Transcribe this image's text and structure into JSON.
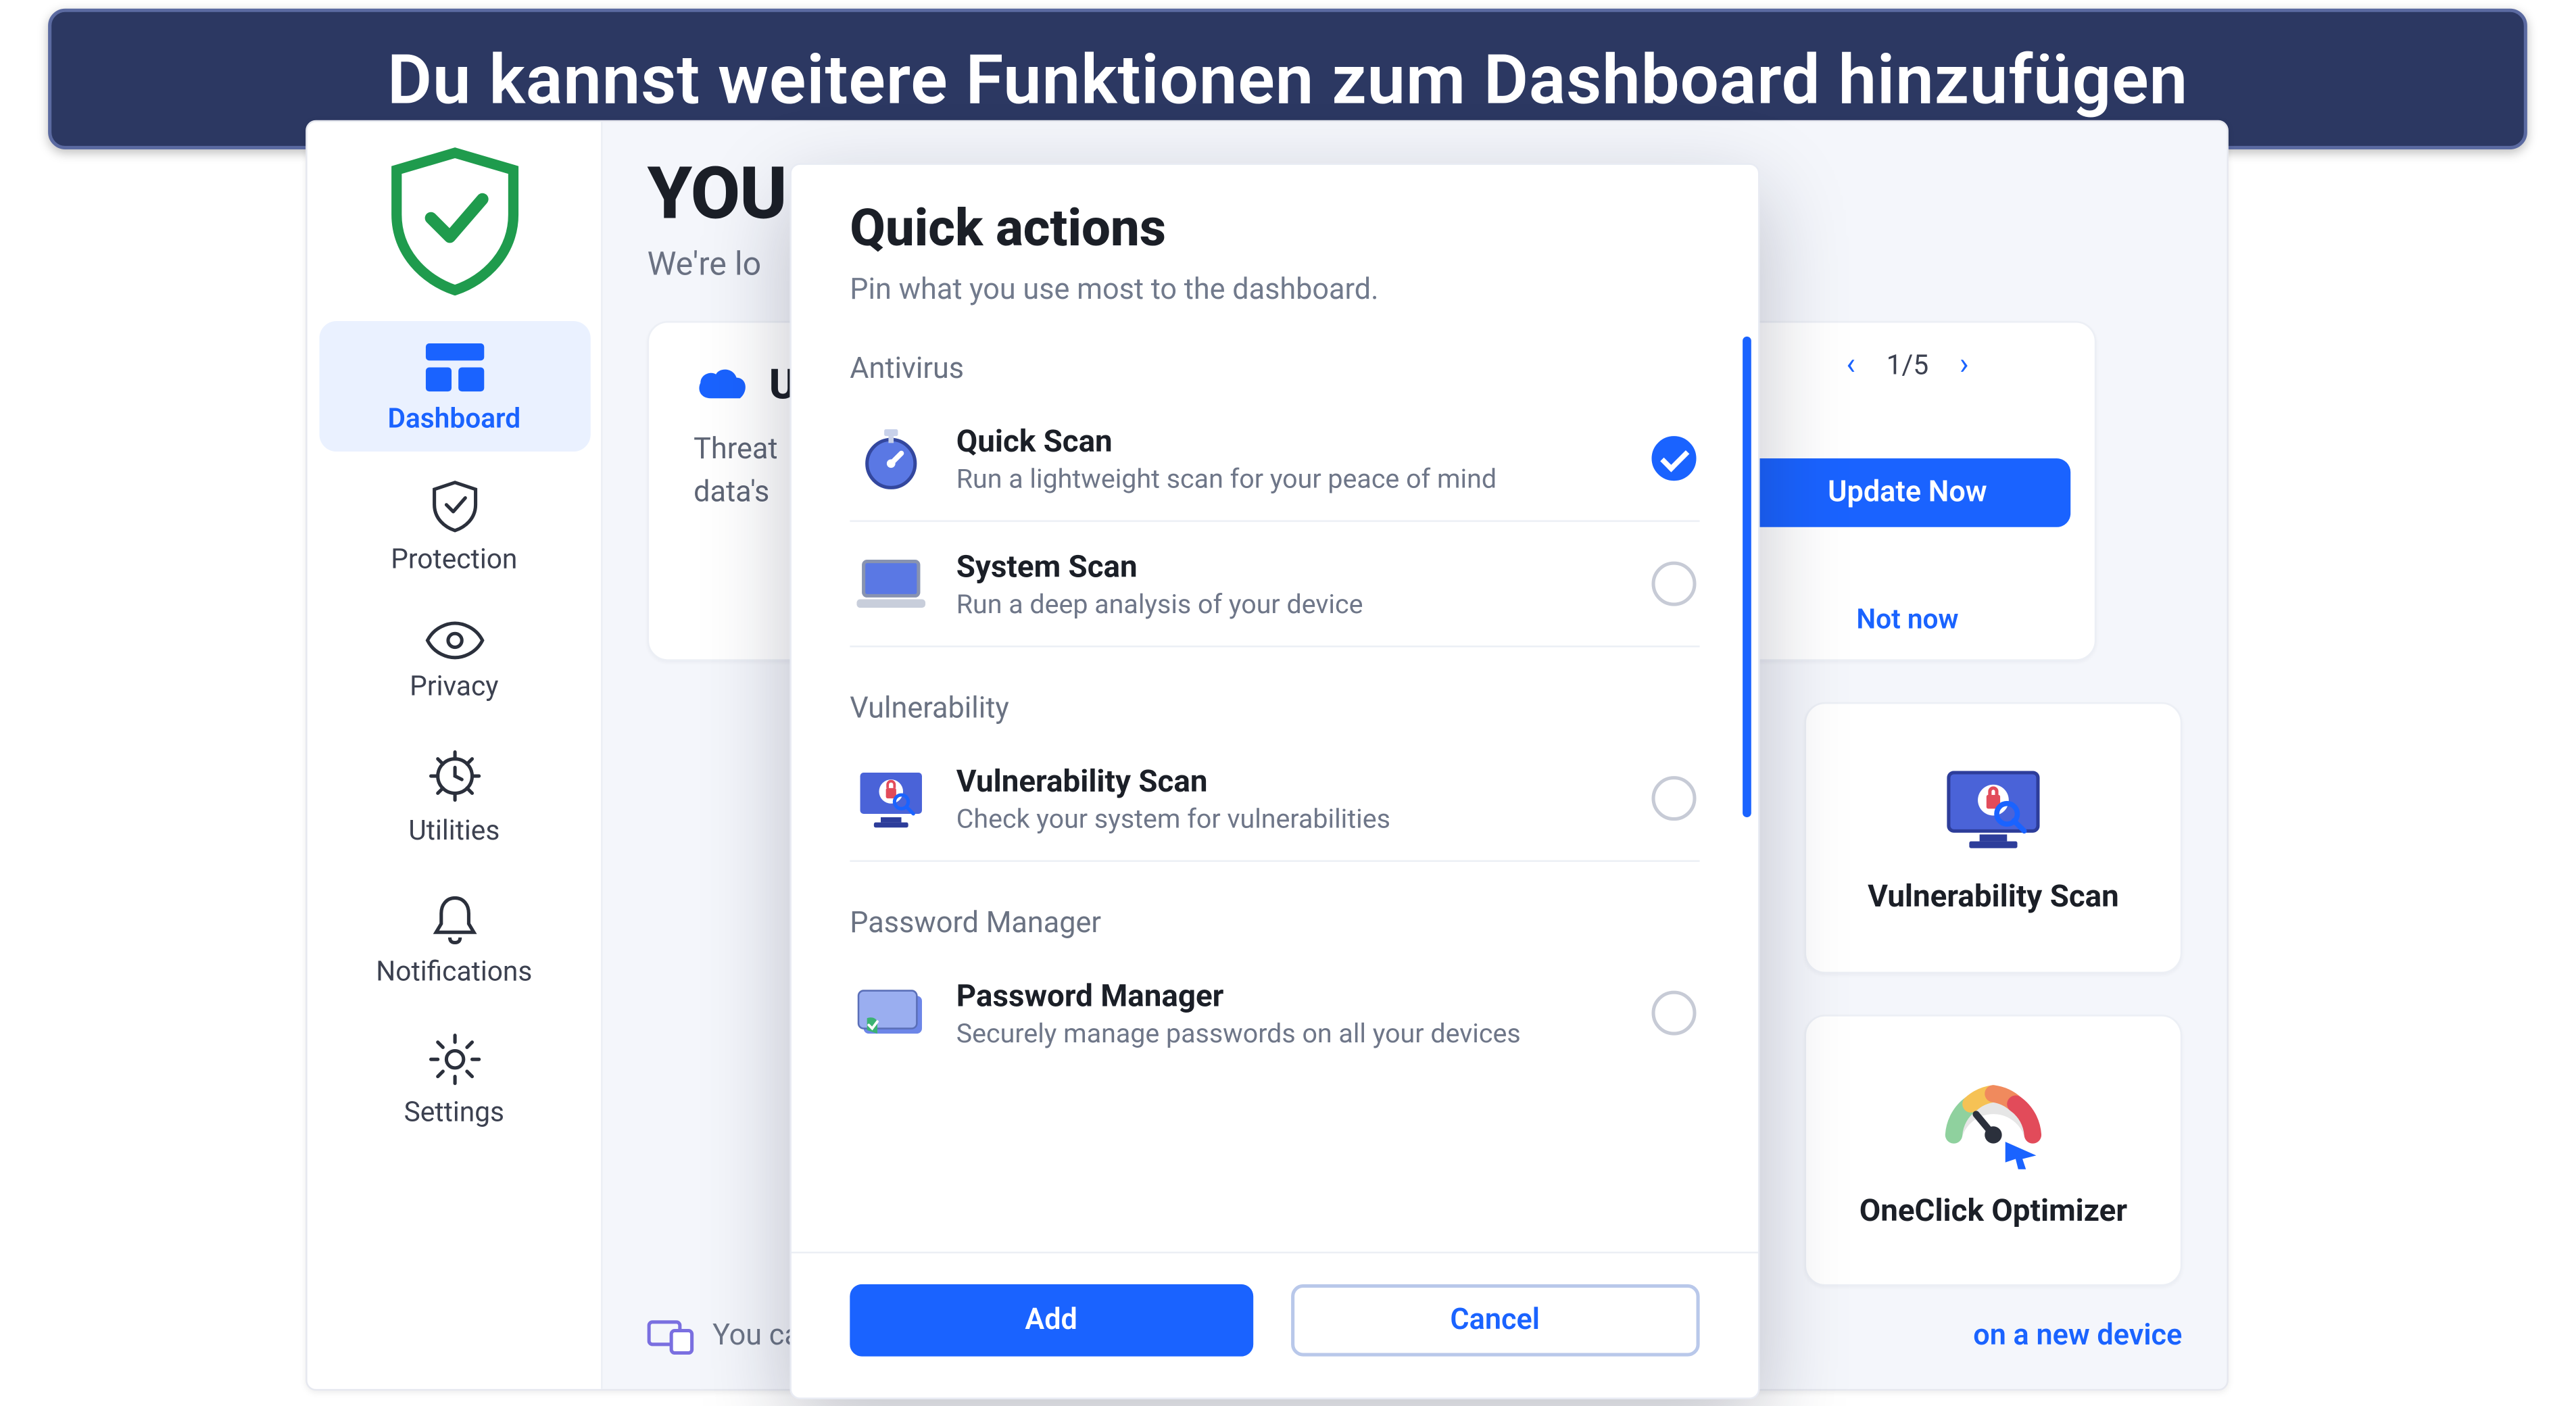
{
  "banner": {
    "text": "Du kannst weitere Funktionen zum Dashboard hinzufügen"
  },
  "sidebar": {
    "items": [
      {
        "label": "Dashboard"
      },
      {
        "label": "Protection"
      },
      {
        "label": "Privacy"
      },
      {
        "label": "Utilities"
      },
      {
        "label": "Notifications"
      },
      {
        "label": "Settings"
      }
    ]
  },
  "header": {
    "title_fragment": "YOU",
    "subtitle_fragment": "We're lo"
  },
  "threat_card": {
    "icon": "cloud-icon",
    "title_fragment": "U",
    "line1_fragment": "Threat",
    "line2_fragment": "data's"
  },
  "update_card": {
    "pager": {
      "current": "1",
      "total": "5",
      "display": "1/5"
    },
    "primary": "Update Now",
    "dismiss": "Not now"
  },
  "tiles": [
    {
      "label": "Vulnerability Scan"
    },
    {
      "label": "OneClick Optimizer"
    }
  ],
  "bottom": {
    "prefix": "You ca",
    "link_fragment": "on a new device"
  },
  "modal": {
    "title": "Quick actions",
    "subtitle": "Pin what you use most to the dashboard.",
    "sections": [
      {
        "heading": "Antivirus",
        "items": [
          {
            "name": "Quick Scan",
            "desc": "Run a lightweight scan for your peace of mind",
            "checked": true
          },
          {
            "name": "System Scan",
            "desc": "Run a deep analysis of your device",
            "checked": false
          }
        ]
      },
      {
        "heading": "Vulnerability",
        "items": [
          {
            "name": "Vulnerability Scan",
            "desc": "Check your system for vulnerabilities",
            "checked": false
          }
        ]
      },
      {
        "heading": "Password Manager",
        "items": [
          {
            "name": "Password Manager",
            "desc": "Securely manage passwords on all your devices",
            "checked": false
          }
        ]
      }
    ],
    "buttons": {
      "add": "Add",
      "cancel": "Cancel"
    }
  },
  "colors": {
    "accent": "#1a63ff",
    "banner": "#2c3862"
  }
}
